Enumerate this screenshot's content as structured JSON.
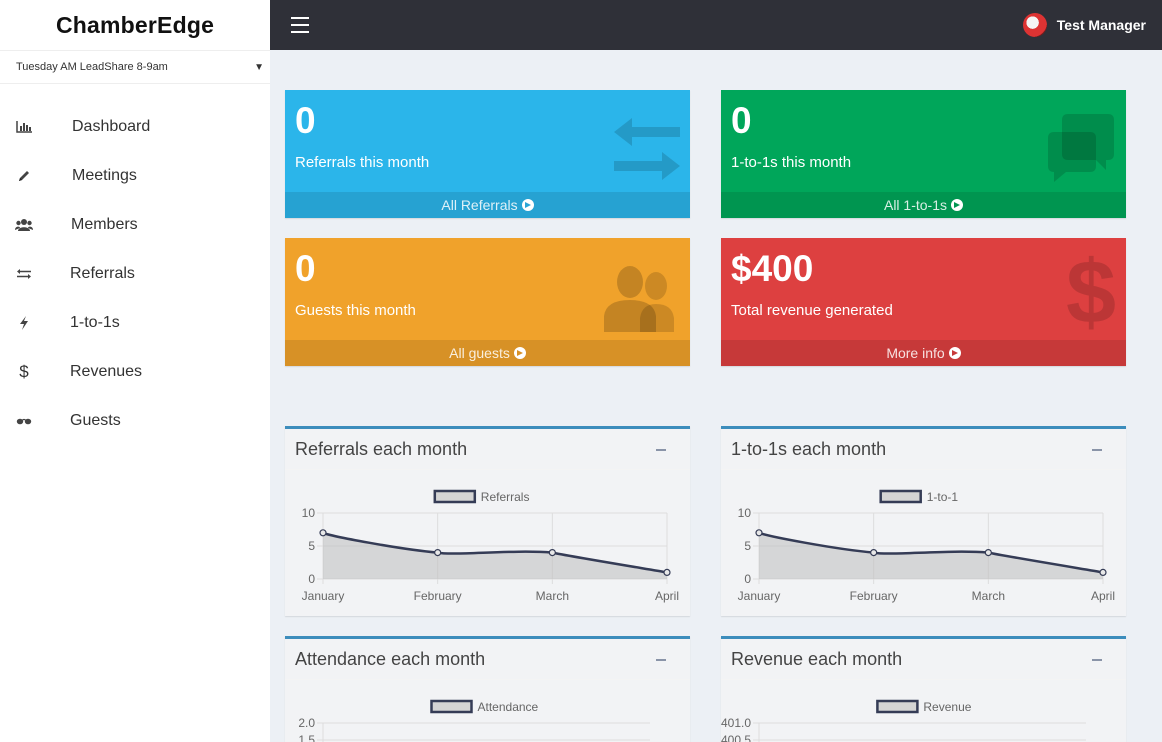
{
  "app": {
    "logo": "ChamberEdge"
  },
  "group_selector": {
    "value": "Tuesday AM LeadShare 8-9am"
  },
  "sidebar": {
    "items": [
      {
        "label": "Dashboard",
        "icon": "bar-chart-icon"
      },
      {
        "label": "Meetings",
        "icon": "pencil-icon"
      },
      {
        "label": "Members",
        "icon": "users-icon"
      },
      {
        "label": "Referrals",
        "icon": "exchange-icon"
      },
      {
        "label": "1-to-1s",
        "icon": "bolt-icon"
      },
      {
        "label": "Revenues",
        "icon": "dollar-icon"
      },
      {
        "label": "Guests",
        "icon": "glasses-icon"
      }
    ]
  },
  "header": {
    "user_name": "Test Manager"
  },
  "stats": [
    {
      "value": "0",
      "label": "Referrals this month",
      "link": "All Referrals",
      "color": "#2bb5ea",
      "icon": "exchange-icon"
    },
    {
      "value": "0",
      "label": "1-to-1s this month",
      "link": "All 1-to-1s",
      "color": "#00a65a",
      "icon": "comments-icon"
    },
    {
      "value": "0",
      "label": "Guests this month",
      "link": "All guests",
      "color": "#f0a22b",
      "icon": "users-icon"
    },
    {
      "value": "$400",
      "label": "Total revenue generated",
      "link": "More info",
      "color": "#dd4040",
      "icon": "dollar-icon"
    }
  ],
  "panels": [
    {
      "title": "Referrals each month"
    },
    {
      "title": "1-to-1s each month"
    },
    {
      "title": "Attendance each month"
    },
    {
      "title": "Revenue each month"
    }
  ],
  "chart_data": [
    {
      "type": "line",
      "categories": [
        "January",
        "February",
        "March",
        "April"
      ],
      "series": [
        {
          "name": "Referrals",
          "values": [
            7,
            4,
            4,
            1
          ]
        }
      ],
      "yticks": [
        "10",
        "5",
        "0"
      ],
      "ylim": [
        0,
        10
      ],
      "legend": "top-center"
    },
    {
      "type": "line",
      "categories": [
        "January",
        "February",
        "March",
        "April"
      ],
      "series": [
        {
          "name": "1-to-1",
          "values": [
            7,
            4,
            4,
            1
          ]
        }
      ],
      "yticks": [
        "10",
        "5",
        "0"
      ],
      "ylim": [
        0,
        10
      ],
      "legend": "top-center"
    },
    {
      "type": "line",
      "series": [
        {
          "name": "Attendance"
        }
      ],
      "yticks": [
        "2.0",
        "1.5"
      ],
      "legend": "top-center"
    },
    {
      "type": "line",
      "series": [
        {
          "name": "Revenue"
        }
      ],
      "yticks": [
        "401.0",
        "400.5"
      ],
      "legend": "top-center"
    }
  ]
}
